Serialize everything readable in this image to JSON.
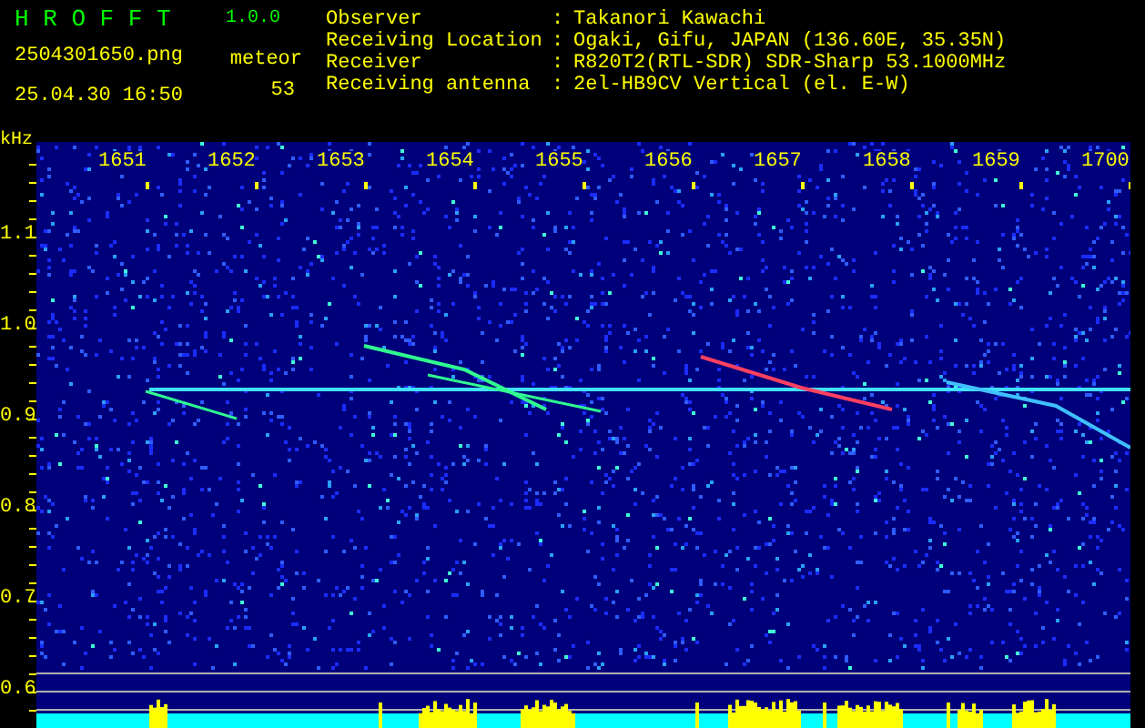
{
  "header": {
    "app_title": "H R O F F T",
    "version": "1.0.0",
    "file_name": "2504301650.png",
    "meteor_label": "meteor",
    "timestamp": "25.04.30 16:50",
    "meteor_count": "53",
    "info": [
      {
        "label": "Observer",
        "separator": ":",
        "value": "Takanori Kawachi"
      },
      {
        "label": "Receiving Location",
        "separator": ":",
        "value": "Ogaki, Gifu, JAPAN (136.60E, 35.35N)"
      },
      {
        "label": "Receiver",
        "separator": ":",
        "value": "R820T2(RTL-SDR) SDR-Sharp 53.1000MHz"
      },
      {
        "label": "Receiving antenna",
        "separator": ":",
        "value": "2el-HB9CV Vertical (el. E-W)"
      }
    ]
  },
  "spectrogram": {
    "y_unit": "kHz",
    "time_labels": [
      "1651",
      "1652",
      "1653",
      "1654",
      "1655",
      "1656",
      "1657",
      "1658",
      "1659",
      "1700"
    ],
    "freq_labels": [
      "1.1",
      "1.0",
      "0.9",
      "0.8",
      "0.7",
      "0.6"
    ]
  }
}
